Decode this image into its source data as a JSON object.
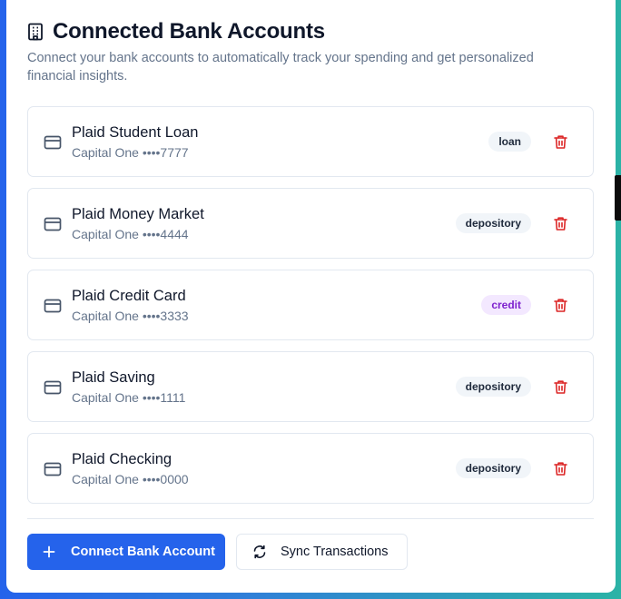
{
  "header": {
    "title": "Connected Bank Accounts",
    "subtitle": "Connect your bank accounts to automatically track your spending and get personalized financial insights."
  },
  "accounts": [
    {
      "name": "Plaid Student Loan",
      "institution": "Capital One ••••7777",
      "type": "loan"
    },
    {
      "name": "Plaid Money Market",
      "institution": "Capital One ••••4444",
      "type": "depository"
    },
    {
      "name": "Plaid Credit Card",
      "institution": "Capital One ••••3333",
      "type": "credit"
    },
    {
      "name": "Plaid Saving",
      "institution": "Capital One ••••1111",
      "type": "depository"
    },
    {
      "name": "Plaid Checking",
      "institution": "Capital One ••••0000",
      "type": "depository"
    }
  ],
  "actions": {
    "connect_label": "Connect Bank Account",
    "sync_label": "Sync Transactions"
  },
  "icons": {
    "title": "building-icon",
    "account": "credit-card-icon",
    "delete": "trash-icon",
    "connect": "plus-icon",
    "sync": "refresh-icon"
  },
  "colors": {
    "primary": "#2563eb",
    "delete": "#dc2626",
    "credit_badge_bg": "#f3e8ff",
    "credit_badge_text": "#7e22ce",
    "default_badge_bg": "#f1f5f9"
  }
}
